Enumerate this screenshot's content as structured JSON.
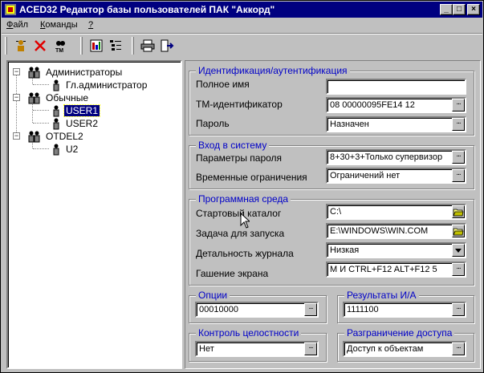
{
  "window": {
    "title": "ACED32 Редактор базы пользователей ПАК \"Аккорд\"",
    "buttons": {
      "minimize": "_",
      "maximize": "□",
      "close": "×"
    }
  },
  "menu": [
    {
      "label": "Файл",
      "underline": "Ф",
      "rest": "айл"
    },
    {
      "label": "Команды",
      "underline": "К",
      "rest": "оманды"
    },
    {
      "label": "?",
      "underline": "?",
      "rest": ""
    }
  ],
  "toolbar": {
    "icons": [
      "add-user-icon",
      "delete-icon",
      "identifier-icon",
      "report-icon",
      "tree-list-icon",
      "print-icon",
      "exit-icon"
    ]
  },
  "tree": [
    {
      "label": "Администраторы",
      "expanded": true,
      "children": [
        {
          "label": "Гл.администратор"
        }
      ]
    },
    {
      "label": "Обычные",
      "expanded": true,
      "children": [
        {
          "label": "USER1",
          "selected": true
        },
        {
          "label": "USER2"
        }
      ]
    },
    {
      "label": "OTDEL2",
      "expanded": true,
      "children": [
        {
          "label": "U2"
        }
      ]
    }
  ],
  "groups": {
    "identification": {
      "title": "Идентификация/аутентификация",
      "full_name_label": "Полное имя",
      "full_name_value": "",
      "tm_label": "ТМ-идентификатор",
      "tm_value": "08 00000095FE14 12",
      "password_label": "Пароль",
      "password_value": "Назначен"
    },
    "login": {
      "title": "Вход в систему",
      "pw_params_label": "Параметры пароля",
      "pw_params_value": "8+30+3+Только супервизор",
      "time_label": "Временные ограничения",
      "time_value": "Ограничений нет"
    },
    "environment": {
      "title": "Программная среда",
      "start_dir_label": "Стартовый каталог",
      "start_dir_value": "C:\\",
      "task_label": "Задача для запуска",
      "task_value": "E:\\WINDOWS\\WIN.COM",
      "log_detail_label": "Детальность журнала",
      "log_detail_value": "Низкая",
      "screen_blank_label": "Гашение экрана",
      "screen_blank_value": "M  И CTRL+F12 ALT+F12 5"
    },
    "options": {
      "title": "Опции",
      "value": "00010000"
    },
    "results": {
      "title": "Результаты И/А",
      "value": "1111100"
    },
    "integrity": {
      "title": "Контроль целостности",
      "value": "Нет"
    },
    "access": {
      "title": "Разграничение доступа",
      "value": "Доступ к объектам"
    }
  },
  "colors": {
    "title_bar": "#000080",
    "group_title": "#0000c8",
    "face": "#c0c0c0"
  }
}
